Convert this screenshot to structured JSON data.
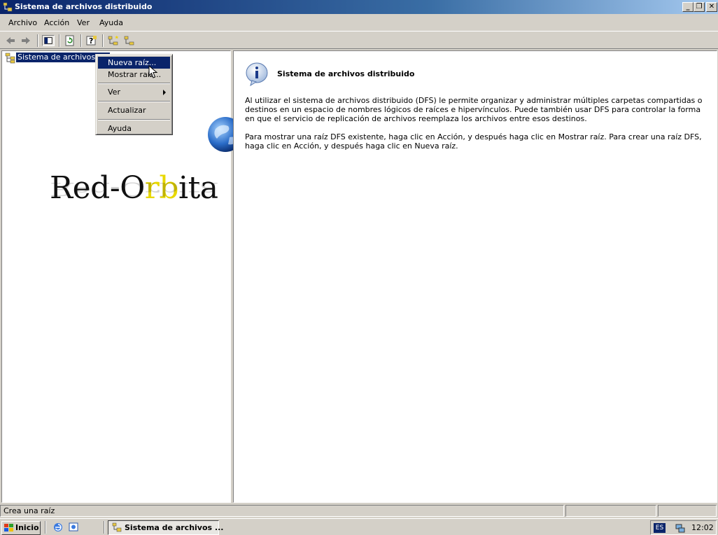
{
  "window": {
    "title": "Sistema de archivos distribuido",
    "controls": {
      "minimize": "_",
      "restore": "❐",
      "close": "✕"
    }
  },
  "menubar": {
    "items": [
      {
        "label": "Archivo"
      },
      {
        "label": "Acción"
      },
      {
        "label": "Ver"
      },
      {
        "label": "Ayuda"
      }
    ]
  },
  "toolbar": {
    "icons": [
      "back-arrow-icon",
      "forward-arrow-icon",
      "show-hide-tree-icon",
      "refresh-icon",
      "help-icon",
      "new-root-icon",
      "show-root-icon"
    ]
  },
  "tree": {
    "root_label": "Sistema de archivos dis"
  },
  "context_menu": {
    "items": [
      {
        "label": "Nueva raíz...",
        "selected": true
      },
      {
        "label": "Mostrar raíz..."
      },
      {
        "label": "Ver",
        "submenu": true
      },
      {
        "label": "Actualizar"
      },
      {
        "label": "Ayuda"
      }
    ]
  },
  "watermark": {
    "text_pre": "Red-O",
    "text_r": "r",
    "text_b": "b",
    "text_post": "ita"
  },
  "content": {
    "title": "Sistema de archivos distribuido",
    "paragraph1": "Al utilizar el sistema de archivos distribuido (DFS) le permite organizar y administrar múltiples carpetas compartidas o destinos en un espacio de nombres lógicos de raíces e hipervínculos. Puede también usar DFS para controlar la forma en que el servicio de replicación de archivos reemplaza los archivos entre esos destinos.",
    "paragraph2": "Para mostrar una raíz DFS existente, haga clic en Acción, y después haga clic en Mostrar raíz. Para crear una raíz DFS, haga clic en Acción, y después haga clic en Nueva raíz."
  },
  "statusbar": {
    "text": "Crea una raíz"
  },
  "taskbar": {
    "start_label": "Inicio",
    "task_label": "Sistema de archivos ...",
    "lang": "ES",
    "clock": "12:02"
  },
  "colors": {
    "selection": "#0a246a",
    "face": "#d4d0c8",
    "title_gradient_start": "#0a246a",
    "title_gradient_end": "#a6caf0"
  }
}
